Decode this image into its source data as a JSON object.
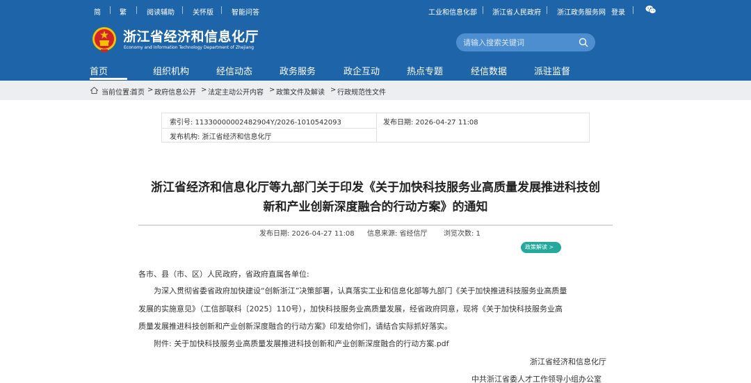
{
  "topbar": {
    "simplified": "简",
    "traditional": "繁",
    "reading_aid": "阅读辅助",
    "care_edition": "关怀版",
    "smart_qa": "智能问答",
    "miit": "工业和信息化部",
    "zj_gov": "浙江省人民政府",
    "zj_service": "浙江政务服务网",
    "login": "登录",
    "wechat_icon": "wechat-icon"
  },
  "site": {
    "title": "浙江省经济和信息化厅",
    "subtitle": "Economy and Information Technology Department of Zhejiang",
    "emblem_icon": "national-emblem"
  },
  "search": {
    "placeholder": "请输入搜索关键词"
  },
  "nav": {
    "items": [
      "首页",
      "组织机构",
      "经信动态",
      "政务服务",
      "政企互动",
      "热点专题",
      "经信数据",
      "派驻监督"
    ],
    "active_index": 0
  },
  "breadcrumb": {
    "label": "当前位置:",
    "items": [
      "首页",
      "政府信息公开",
      "法定主动公开内容",
      "政策文件及解读",
      "行政规范性文件"
    ],
    "separator": ">"
  },
  "info": {
    "index_no": "索引号: 11330000002482904Y/2026-1010542093",
    "publish_date": "发布日期: 2026-04-27 11:08",
    "publisher": "发布机构: 浙江省经济和信息化厅"
  },
  "article": {
    "title_line1": "浙江省经济和信息化厅等九部门关于印发《关于加快科技服务业高质量发展推进科技创",
    "title_line2": "新和产业创新深度融合的行动方案》的通知",
    "meta_date": "发布日期: 2026-04-27 11:08",
    "meta_source": "信息来源: 省经信厅",
    "meta_views": "浏览次数: 1",
    "policy_button": "政策解读 >",
    "salutation": "各市、县（市、区）人民政府，省政府直属各单位:",
    "para1_line1": "为深入贯彻省委省政府加快建设“创新浙江”决策部署，认真落实工业和信息化部等九部门《关于加快推进科技服务业高质量",
    "para1_line2": "发展的实施意见》（工信部联科〔2025〕110号），加快科技服务业高质量发展，经省政府同意，现将《关于加快科技服务业高",
    "para1_line3": "质量发展推进科技创新和产业创新深度融合的行动方案》印发给你们，请结合实际抓好落实。",
    "attachment": "附件: 关于加快科技服务业高质量发展推进科技创新和产业创新深度融合的行动方案.pdf",
    "signature1": "浙江省经济和信息化厅",
    "signature2": "中共浙江省委人才工作领导小组办公室"
  },
  "colors": {
    "header_blue": "#1e64a8",
    "search_bg": "#4d8ed0",
    "crumb_bg": "#eceeef",
    "teal": "#24a99d",
    "emblem_red": "#d2232a",
    "emblem_gold": "#f2c200"
  }
}
